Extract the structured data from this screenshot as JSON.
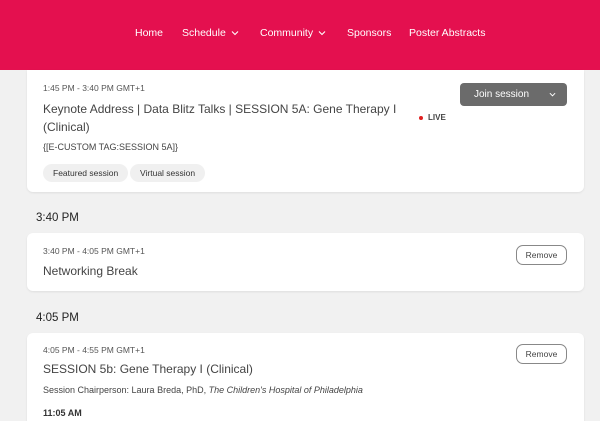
{
  "nav": {
    "items": [
      {
        "label": "Home",
        "dropdown": false
      },
      {
        "label": "Schedule",
        "dropdown": true
      },
      {
        "label": "Community",
        "dropdown": true
      },
      {
        "label": "Sponsors",
        "dropdown": false
      },
      {
        "label": "Poster Abstracts",
        "dropdown": false
      }
    ]
  },
  "sessions": [
    {
      "time": "1:45 PM - 3:40 PM GMT+1",
      "title_line1": "Keynote Address | Data Blitz Talks | SESSION 5A: Gene Therapy I",
      "title_line2": "(Clinical)",
      "custom_tag": "{[E-CUSTOM TAG:SESSION 5A]}",
      "tags": [
        "Featured session",
        "Virtual session"
      ],
      "status": "LIVE",
      "action": "Join session"
    },
    {
      "slot_heading": "3:40 PM",
      "time": "3:40 PM - 4:05 PM GMT+1",
      "title": "Networking Break",
      "action": "Remove"
    },
    {
      "slot_heading": "4:05 PM",
      "time": "4:05 PM - 4:55 PM GMT+1",
      "title": "SESSION 5b: Gene Therapy I (Clinical)",
      "chair_prefix": "Session Chairperson: Laura Breda, PhD, ",
      "chair_affiliation": "The Children's Hospital of Philadelphia",
      "next_time": "11:05 AM",
      "action": "Remove"
    }
  ],
  "colors": {
    "brand": "#e4104f",
    "join_button": "#6b6b6b",
    "live_dot": "#e02020"
  }
}
